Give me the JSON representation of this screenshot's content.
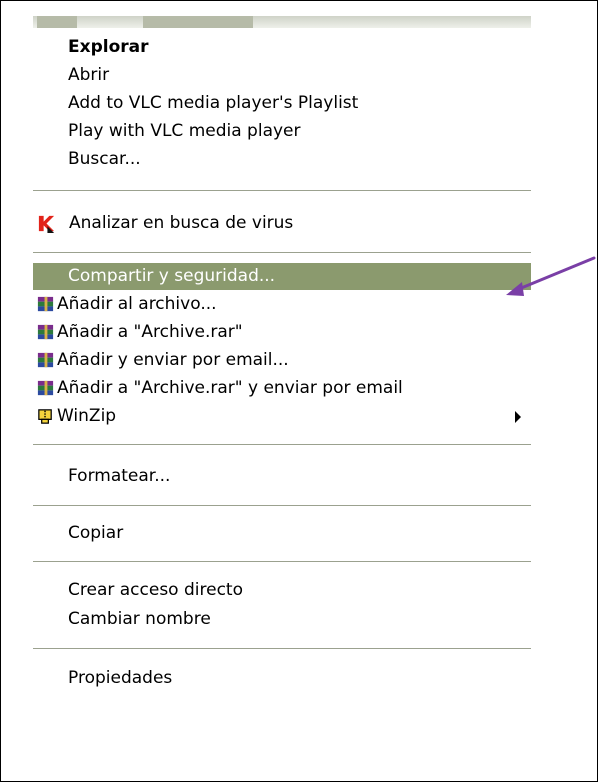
{
  "menu": {
    "items": [
      {
        "id": "explorar",
        "label": "Explorar"
      },
      {
        "id": "abrir",
        "label": "Abrir"
      },
      {
        "id": "vlc_playlist",
        "label": "Add to VLC media player's Playlist"
      },
      {
        "id": "vlc_play",
        "label": "Play with VLC media player"
      },
      {
        "id": "buscar",
        "label": "Buscar..."
      },
      {
        "id": "analizar",
        "label": "Analizar en busca de virus",
        "icon": "kaspersky-icon"
      },
      {
        "id": "compartir",
        "label": "Compartir y seguridad..."
      },
      {
        "id": "anadir_archivo",
        "label": "Añadir al archivo...",
        "icon": "winrar-icon"
      },
      {
        "id": "anadir_archive_rar",
        "label": "Añadir a \"Archive.rar\"",
        "icon": "winrar-icon"
      },
      {
        "id": "anadir_enviar",
        "label": "Añadir y enviar por email...",
        "icon": "winrar-icon"
      },
      {
        "id": "anadir_archive_enviar",
        "label": "Añadir a \"Archive.rar\" y enviar por email",
        "icon": "winrar-icon"
      },
      {
        "id": "winzip",
        "label": "WinZip",
        "icon": "winzip-icon",
        "submenu": true
      },
      {
        "id": "formatear",
        "label": "Formatear..."
      },
      {
        "id": "copiar",
        "label": "Copiar"
      },
      {
        "id": "crear_acceso",
        "label": "Crear acceso directo"
      },
      {
        "id": "cambiar_nombre",
        "label": "Cambiar nombre"
      },
      {
        "id": "propiedades",
        "label": "Propiedades"
      }
    ],
    "highlighted_item": "compartir"
  },
  "colors": {
    "highlight_bg": "#8b9a6e",
    "annotation_arrow": "#7a3fa6",
    "kaspersky_red": "#e2231a",
    "separator": "#9ba18f"
  }
}
